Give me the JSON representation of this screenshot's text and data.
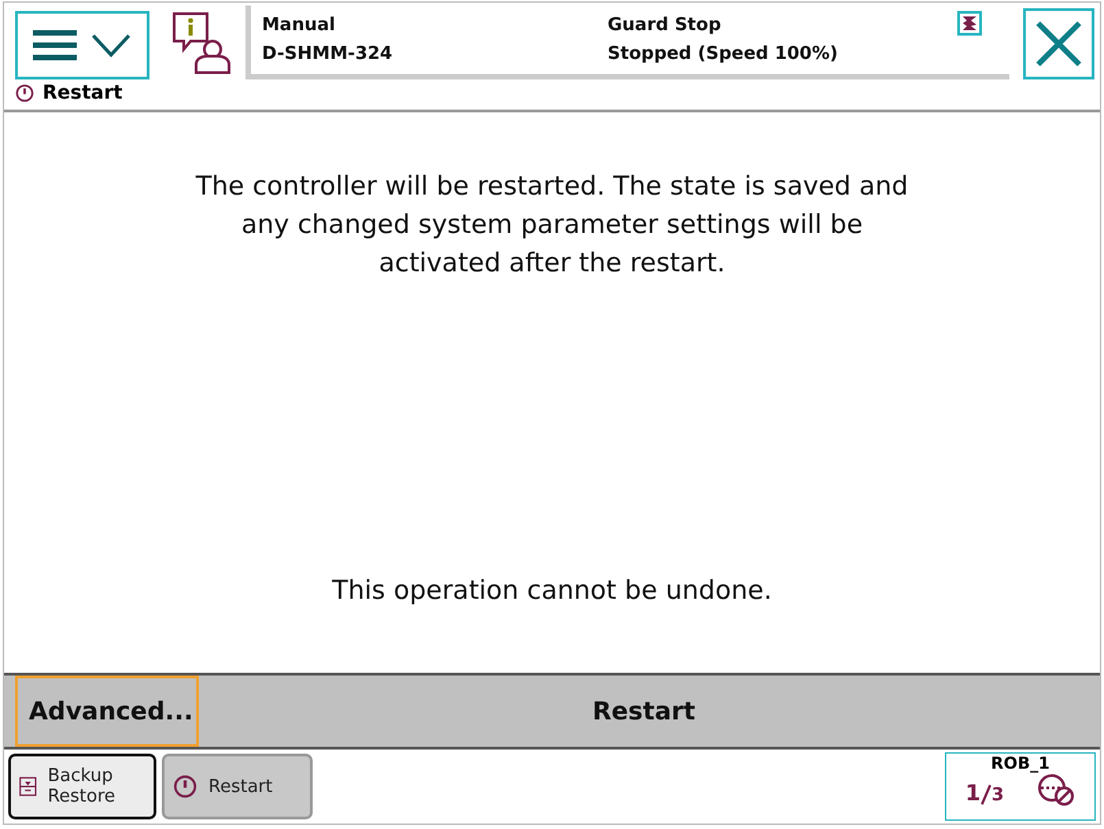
{
  "status": {
    "mode": "Manual",
    "system": "D-SHMM-324",
    "state": "Guard Stop",
    "motion": "Stopped (Speed 100%)"
  },
  "view_title": "Restart",
  "message": [
    "The controller will be restarted. The state is saved and any changed system parameter settings will be activated after the restart.",
    "This operation cannot be undone."
  ],
  "actions": [
    {
      "label": "Advanced...",
      "focused": true
    },
    {
      "label": "Restart",
      "focused": false
    }
  ],
  "taskbar": [
    {
      "label": "Backup Restore",
      "kind": "backup",
      "selected": false
    },
    {
      "label": "Restart",
      "kind": "restart",
      "selected": true
    }
  ],
  "quickset": {
    "unit": "ROB_1",
    "numerator": "1",
    "denominator": "3"
  }
}
